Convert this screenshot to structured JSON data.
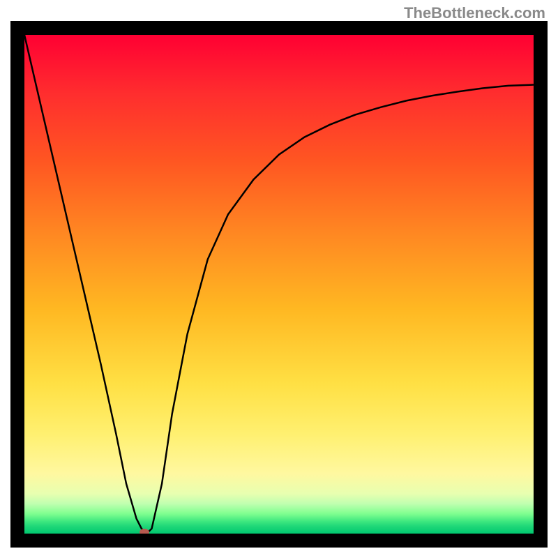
{
  "watermark": "TheBottleneck.com",
  "chart_data": {
    "type": "line",
    "title": "",
    "xlabel": "",
    "ylabel": "",
    "xlim": [
      0,
      100
    ],
    "ylim": [
      0,
      100
    ],
    "grid": false,
    "series": [
      {
        "name": "curve",
        "x": [
          0,
          5,
          10,
          15,
          18,
          20,
          22,
          23,
          24,
          25,
          27,
          29,
          32,
          36,
          40,
          45,
          50,
          55,
          60,
          65,
          70,
          75,
          80,
          85,
          90,
          95,
          100
        ],
        "values": [
          100,
          78,
          56,
          34,
          20,
          10,
          3,
          1,
          0,
          1,
          10,
          24,
          40,
          55,
          64,
          71,
          76,
          79.5,
          82,
          84,
          85.5,
          86.8,
          87.8,
          88.6,
          89.3,
          89.8,
          90
        ]
      }
    ],
    "marker": {
      "x": 23.5,
      "y": 0
    },
    "notes": "V-shaped bottleneck curve over vertical rainbow gradient; minimum near x≈23-24 at y≈0; right side asymptotes toward ~90."
  }
}
